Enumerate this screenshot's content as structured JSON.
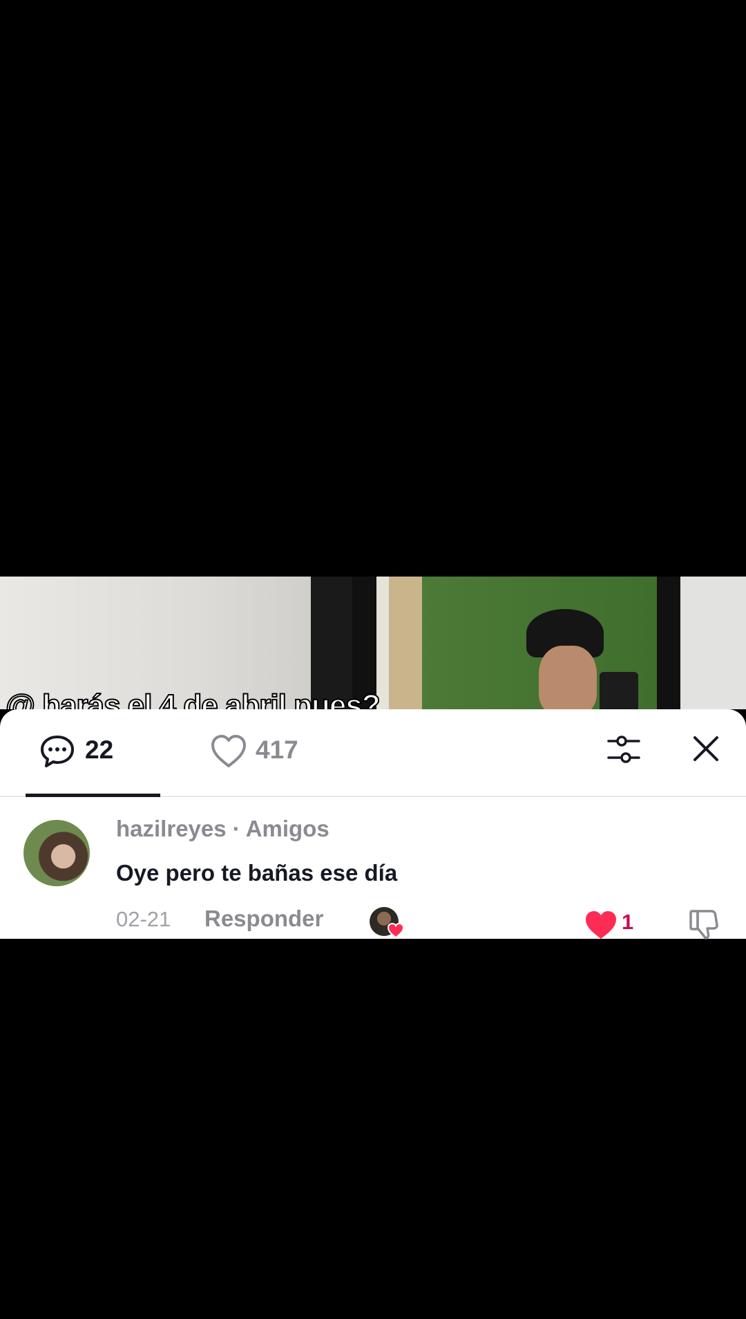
{
  "video": {
    "caption": "@ harás el 4 de abril pues?"
  },
  "tabs": {
    "comments_count": "22",
    "likes_count": "417"
  },
  "comment": {
    "username": "hazilreyes",
    "relation": "· Amigos",
    "text": "Oye pero te bañas ese día",
    "date": "02-21",
    "reply_label": "Responder",
    "like_count": "1"
  },
  "colors": {
    "accent_like": "#fe2c55",
    "text_primary": "#161823",
    "text_secondary": "#8a8b91"
  },
  "icons": [
    "comment-icon",
    "heart-outline-icon",
    "filter-icon",
    "close-icon",
    "heart-filled-icon",
    "dislike-icon"
  ]
}
